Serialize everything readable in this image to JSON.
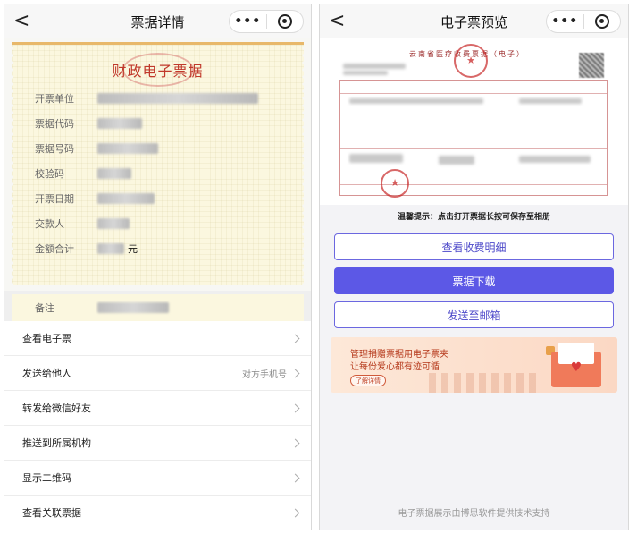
{
  "left": {
    "nav": {
      "back": "<",
      "title": "票据详情",
      "more": "•••"
    },
    "ticket": {
      "title": "财政电子票据",
      "fields": [
        {
          "label": "开票单位"
        },
        {
          "label": "票据代码"
        },
        {
          "label": "票据号码"
        },
        {
          "label": "校验码"
        },
        {
          "label": "开票日期"
        },
        {
          "label": "交款人"
        },
        {
          "label": "金额合计",
          "unit": "元"
        }
      ],
      "remark_label": "备注"
    },
    "menu": [
      {
        "label": "查看电子票",
        "hint": ""
      },
      {
        "label": "发送给他人",
        "hint": "对方手机号"
      },
      {
        "label": "转发给微信好友",
        "hint": ""
      },
      {
        "label": "推送到所属机构",
        "hint": ""
      },
      {
        "label": "显示二维码",
        "hint": ""
      },
      {
        "label": "查看关联票据",
        "hint": ""
      }
    ]
  },
  "right": {
    "nav": {
      "back": "<",
      "title": "电子票预览",
      "more": "•••"
    },
    "invoice_title": "云南省医疗收费票据（电子）",
    "tip": "温馨提示：点击打开票据长按可保存至相册",
    "buttons": {
      "view_detail": "查看收费明细",
      "download": "票据下载",
      "send_email": "发送至邮箱"
    },
    "banner": {
      "line1": "管理捐赠票据用电子票夹",
      "line2": "让每份爱心都有迹可循",
      "cta": "了解详情"
    },
    "footer": "电子票据展示由博思软件提供技术支持"
  }
}
